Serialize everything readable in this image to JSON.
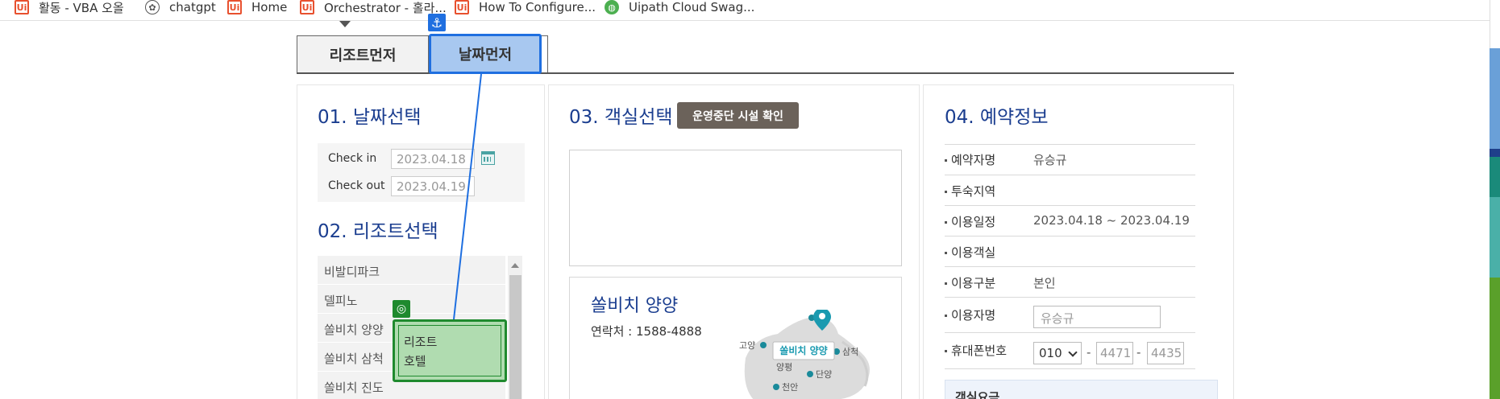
{
  "bookmarks": [
    {
      "label": "활동 - VBA 오올",
      "icon": "uipath-icon"
    },
    {
      "label": "chatgpt",
      "icon": "chatgpt-icon"
    },
    {
      "label": "Home",
      "icon": "uipath-icon"
    },
    {
      "label": "Orchestrator - 홀라...",
      "icon": "uipath-icon"
    },
    {
      "label": "How To Configure...",
      "icon": "uipath-icon"
    },
    {
      "label": "Uipath Cloud Swag...",
      "icon": "web-icon"
    }
  ],
  "tabs": {
    "resort_first": "리조트먼저",
    "date_first": "날짜먼저"
  },
  "section1": {
    "num": "01.",
    "title": "날짜선택",
    "checkin_label": "Check in",
    "checkin_value": "2023.04.18",
    "checkout_label": "Check out",
    "checkout_value": "2023.04.19"
  },
  "section2": {
    "num": "02.",
    "title": "리조트선택",
    "resorts": [
      "비발디파크",
      "델피노",
      "쏠비치 양양",
      "쏠비치 삼척",
      "쏠비치 진도"
    ]
  },
  "section3": {
    "num": "03.",
    "title": "객실선택",
    "closed_button": "운영중단 시설 확인",
    "resort_name": "쏠비치 양양",
    "contact": "연락처 : 1588-4888",
    "map_labels": {
      "highlight": "쏠비치 양양",
      "goyang": "고양",
      "yangpyeong": "양평",
      "samcheok": "삼척",
      "danyang": "단양",
      "cheonan": "천안"
    }
  },
  "section4": {
    "num": "04.",
    "title": "예약정보",
    "rows": [
      {
        "label": "예약자명",
        "value": "유승규"
      },
      {
        "label": "투숙지역",
        "value": ""
      },
      {
        "label": "이용일정",
        "value": "2023.04.18 ~ 2023.04.19"
      },
      {
        "label": "이용객실",
        "value": ""
      },
      {
        "label": "이용구분",
        "value": "본인"
      },
      {
        "label": "이용자명",
        "value": ""
      },
      {
        "label": "휴대폰번호",
        "value": ""
      }
    ],
    "user_name_input": "유승규",
    "phone_prefix": "010",
    "phone_mid": "4471",
    "phone_last": "4435",
    "fee_label": "객실요금"
  },
  "overlay": {
    "target_text_line1": "리조트",
    "target_text_line2": "호텔"
  },
  "colors": {
    "title_blue": "#1a3d8f",
    "overlay_blue": "#1f6fe0",
    "overlay_green": "#1f8a2e",
    "closed_btn": "#6b625a"
  }
}
